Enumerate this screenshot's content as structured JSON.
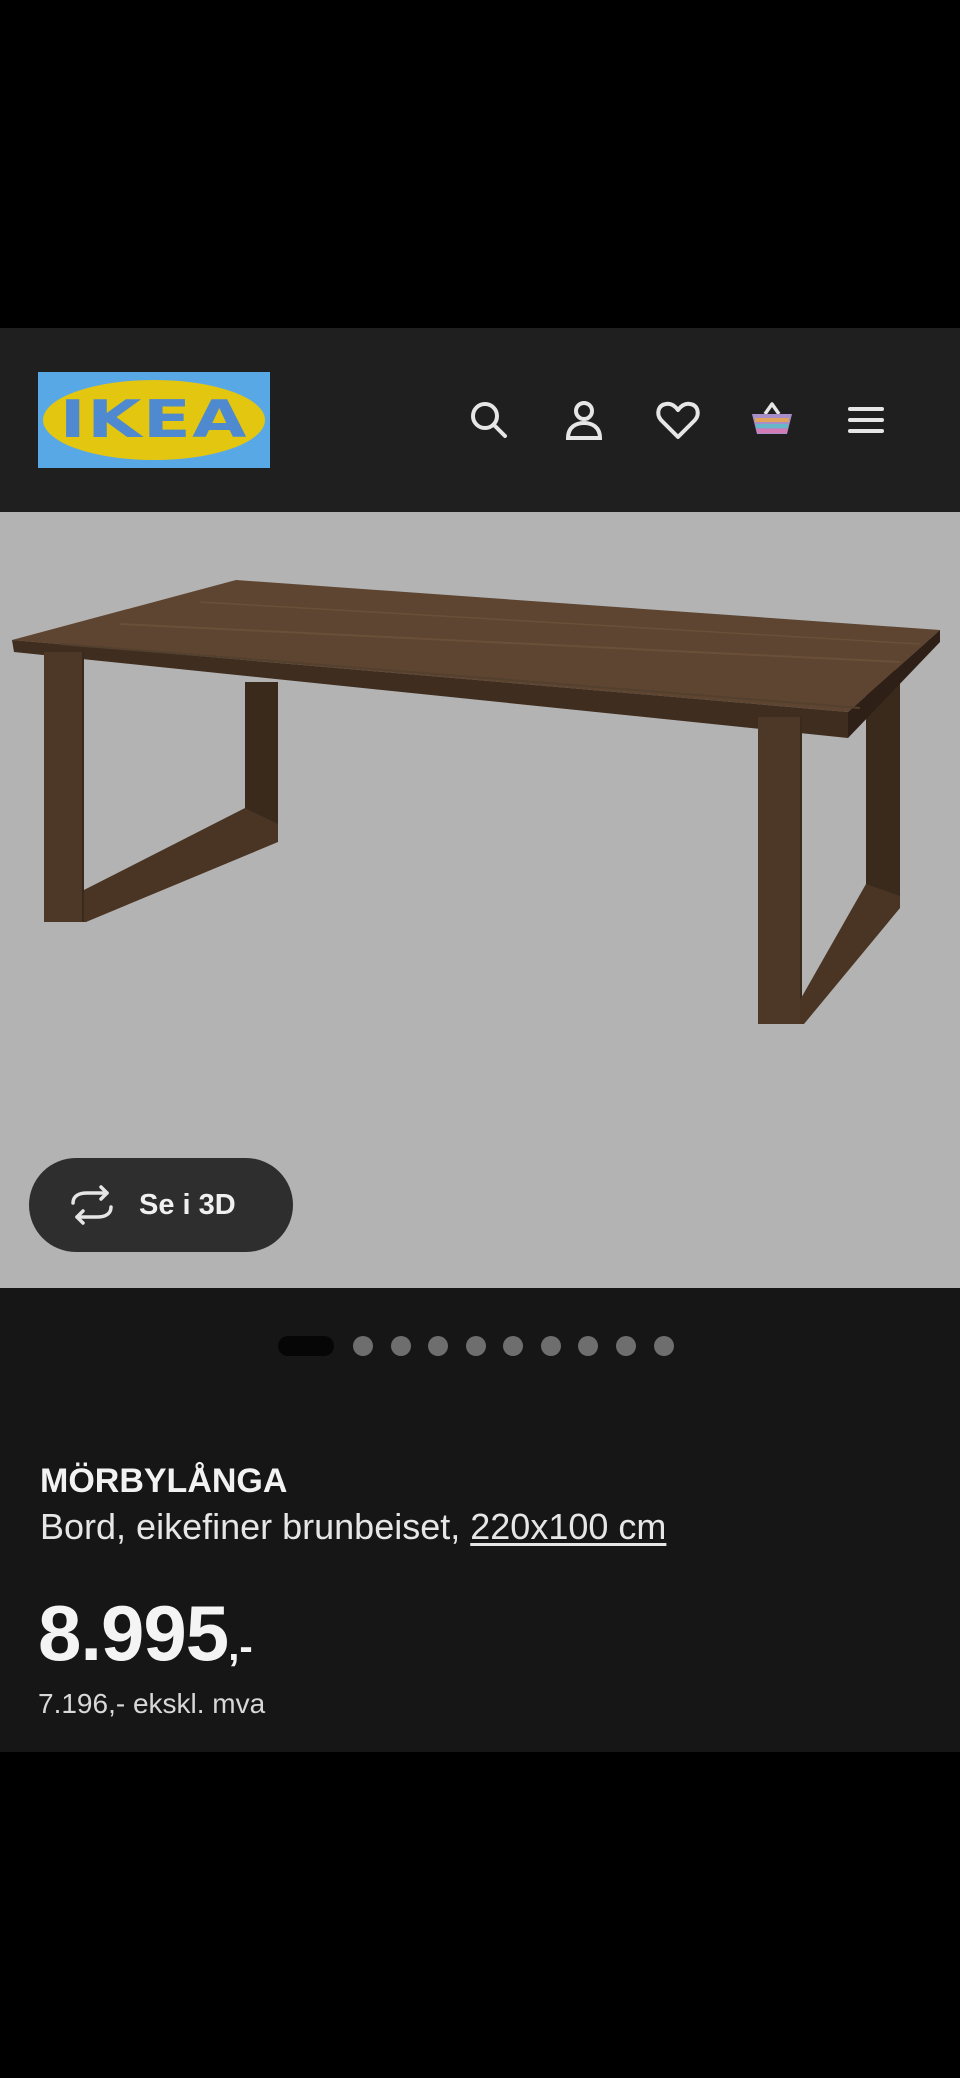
{
  "header": {
    "logo_text": "IKEA",
    "icons": [
      "search-icon",
      "account-icon",
      "heart-icon",
      "basket-icon",
      "menu-icon"
    ]
  },
  "hero": {
    "view_3d_label": "Se i 3D",
    "carousel_total": 10,
    "carousel_active": 1
  },
  "product": {
    "name": "MÖRBYLÅNGA",
    "description": "Bord, eikefiner brunbeiset, ",
    "dimensions": "220x100 cm",
    "price": "8.995",
    "price_suffix": ",-",
    "price_ex_vat": "7.196,- ekskl. mva"
  },
  "colors": {
    "header_bg": "#1f1f1f",
    "logo_blue": "#59a8e6",
    "logo_yellow": "#e3c60f",
    "hero_bg": "#b3b3b3",
    "info_bg": "#161616"
  }
}
